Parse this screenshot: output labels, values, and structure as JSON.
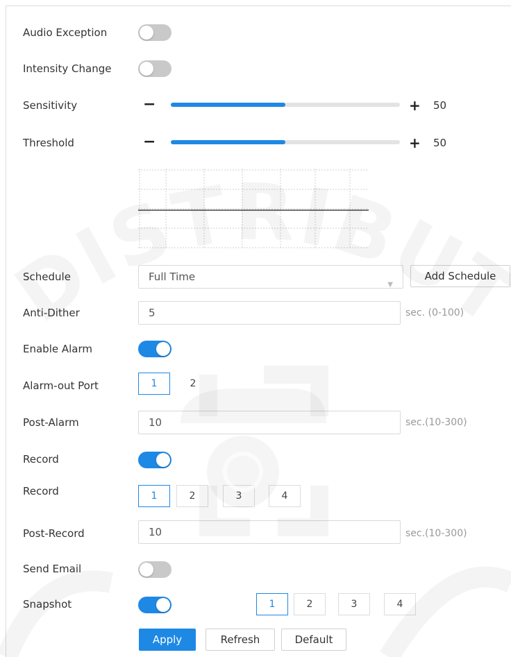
{
  "colors": {
    "accent": "#1e88e5",
    "toggle_off": "#c9c9c9"
  },
  "audio_exception": {
    "label": "Audio Exception",
    "on": false
  },
  "intensity_change": {
    "label": "Intensity Change",
    "on": false
  },
  "sensitivity": {
    "label": "Sensitivity",
    "minus": "−",
    "plus": "+",
    "value": "50",
    "level": 50
  },
  "threshold": {
    "label": "Threshold",
    "minus": "−",
    "plus": "+",
    "value": "50",
    "level": 50
  },
  "schedule": {
    "label": "Schedule",
    "value": "Full Time",
    "add_label": "Add Schedule"
  },
  "anti_dither": {
    "label": "Anti-Dither",
    "value": "5",
    "hint": "sec. (0-100)"
  },
  "enable_alarm": {
    "label": "Enable Alarm",
    "on": true
  },
  "alarm_out_port": {
    "label": "Alarm-out Port",
    "options": [
      "1",
      "2"
    ],
    "selected": "1"
  },
  "post_alarm": {
    "label": "Post-Alarm",
    "value": "10",
    "hint": "sec.(10-300)"
  },
  "record_toggle": {
    "label": "Record",
    "on": true
  },
  "record_channels": {
    "label": "Record",
    "options": [
      "1",
      "2",
      "3",
      "4"
    ],
    "selected": "1"
  },
  "post_record": {
    "label": "Post-Record",
    "value": "10",
    "hint": "sec.(10-300)"
  },
  "send_email": {
    "label": "Send Email",
    "on": false
  },
  "snapshot": {
    "label": "Snapshot",
    "on": true,
    "options": [
      "1",
      "2",
      "3",
      "4"
    ],
    "selected": "1"
  },
  "buttons": {
    "apply": "Apply",
    "refresh": "Refresh",
    "default": "Default"
  },
  "watermark": {
    "text": "DISTRIBUTOR"
  }
}
